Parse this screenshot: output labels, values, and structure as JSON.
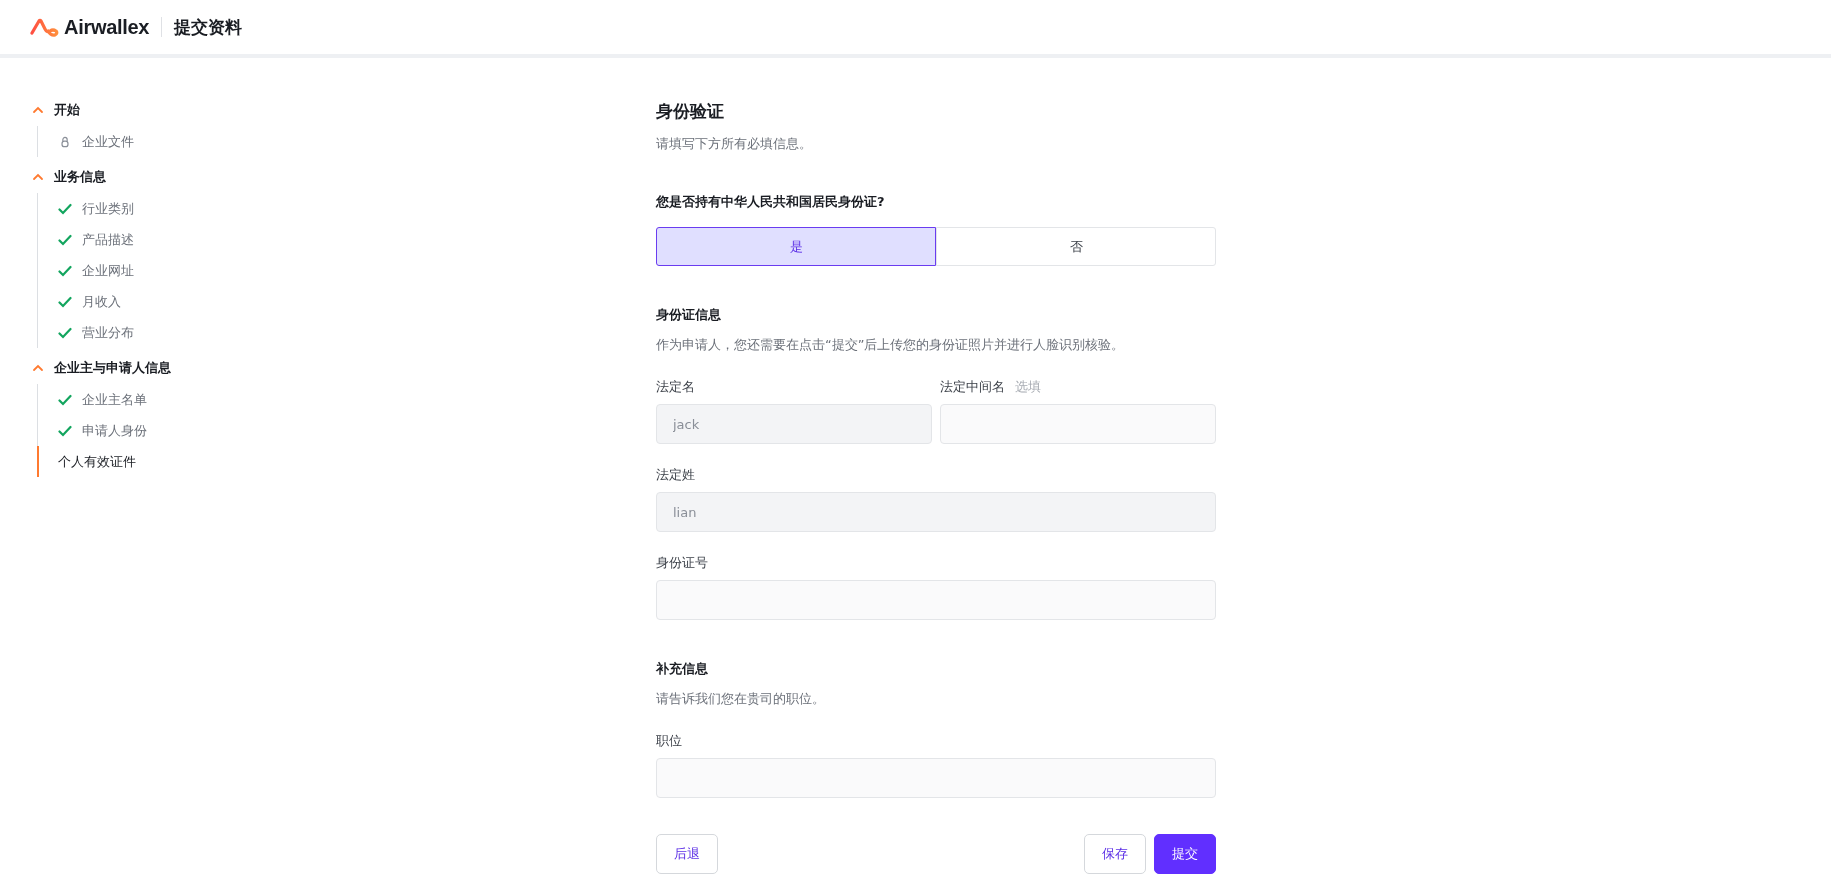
{
  "header": {
    "brand": "Airwallex",
    "title": "提交资料"
  },
  "sidebar": {
    "groups": [
      {
        "title": "开始",
        "expanded": true,
        "items": [
          {
            "label": "企业文件",
            "kind": "lock",
            "selected": false
          }
        ]
      },
      {
        "title": "业务信息",
        "expanded": true,
        "items": [
          {
            "label": "行业类别",
            "kind": "check",
            "selected": false
          },
          {
            "label": "产品描述",
            "kind": "check",
            "selected": false
          },
          {
            "label": "企业网址",
            "kind": "check",
            "selected": false
          },
          {
            "label": "月收入",
            "kind": "check",
            "selected": false
          },
          {
            "label": "营业分布",
            "kind": "check",
            "selected": false
          }
        ]
      },
      {
        "title": "企业主与申请人信息",
        "expanded": true,
        "items": [
          {
            "label": "企业主名单",
            "kind": "check",
            "selected": false
          },
          {
            "label": "申请人身份",
            "kind": "check",
            "selected": false
          },
          {
            "label": "个人有效证件",
            "kind": "none",
            "selected": true
          }
        ]
      }
    ]
  },
  "form": {
    "title": "身份验证",
    "subtitle": "请填写下方所有必填信息。",
    "question": "您是否持有中华人民共和国居民身份证?",
    "options": [
      {
        "label": "是",
        "selected": true
      },
      {
        "label": "否",
        "selected": false
      }
    ],
    "sections": [
      {
        "title": "身份证信息",
        "description": "作为申请人，您还需要在点击“提交”后上传您的身份证照片并进行人脸识别核验。",
        "rows": [
          [
            {
              "label": "法定名",
              "value": "jack",
              "disabled": true
            },
            {
              "label": "法定中间名",
              "optional": "选填"
            }
          ],
          [
            {
              "label": "法定姓",
              "value": "lian",
              "disabled": true
            }
          ],
          [
            {
              "label": "身份证号"
            }
          ]
        ]
      },
      {
        "title": "补充信息",
        "description": "请告诉我们您在贵司的职位。",
        "rows": [
          [
            {
              "label": "职位"
            }
          ]
        ]
      }
    ],
    "buttons": {
      "back": "后退",
      "save": "保存",
      "submit": "提交"
    }
  }
}
